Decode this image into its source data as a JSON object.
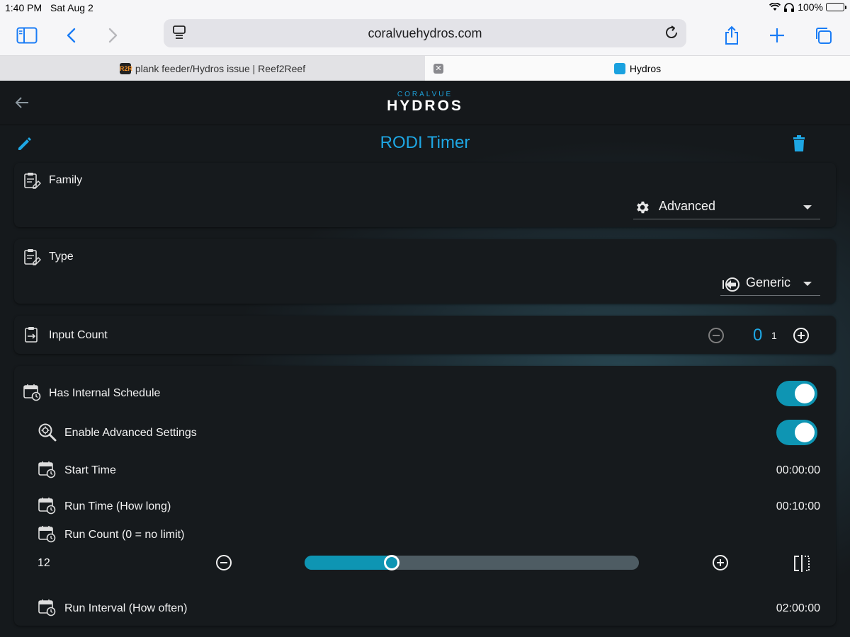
{
  "status_bar": {
    "time": "1:40 PM",
    "date": "Sat Aug 2",
    "battery": "100%"
  },
  "browser": {
    "url": "coralvuehydros.com",
    "tabs": [
      {
        "title": "plank feeder/Hydros issue | Reef2Reef",
        "active": false
      },
      {
        "title": "Hydros",
        "active": true
      }
    ]
  },
  "app": {
    "logo_top": "CORALVUE",
    "logo_main": "HYDROS",
    "page_title": "RODI Timer",
    "family": {
      "label": "Family",
      "value": "Advanced",
      "icon": "clipboard-edit-icon",
      "value_icon": "gear-icon"
    },
    "type": {
      "label": "Type",
      "value": "Generic",
      "icon": "clipboard-edit-icon",
      "value_icon": "input-arrow-icon"
    },
    "input_count": {
      "label": "Input Count",
      "current": "0",
      "max": "1",
      "icon": "clipboard-input-icon"
    },
    "schedule": {
      "has_internal_schedule": {
        "label": "Has Internal Schedule",
        "on": true,
        "icon": "calendar-clock-icon"
      },
      "enable_advanced": {
        "label": "Enable Advanced Settings",
        "on": true,
        "icon": "search-gear-icon"
      },
      "start_time": {
        "label": "Start Time",
        "value": "00:00:00",
        "icon": "calendar-clock-icon"
      },
      "run_time": {
        "label": "Run Time (How long)",
        "value": "00:10:00",
        "icon": "calendar-clock-icon"
      },
      "run_count": {
        "label": "Run Count (0 = no limit)",
        "value": "12",
        "slider_fraction": 0.26,
        "icon": "calendar-clock-icon"
      },
      "run_interval": {
        "label": "Run Interval (How often)",
        "value": "02:00:00",
        "icon": "calendar-clock-icon"
      }
    }
  },
  "colors": {
    "accent": "#1ea7e4",
    "toggle": "#0e95b3",
    "card_bg": "#161a1d"
  }
}
